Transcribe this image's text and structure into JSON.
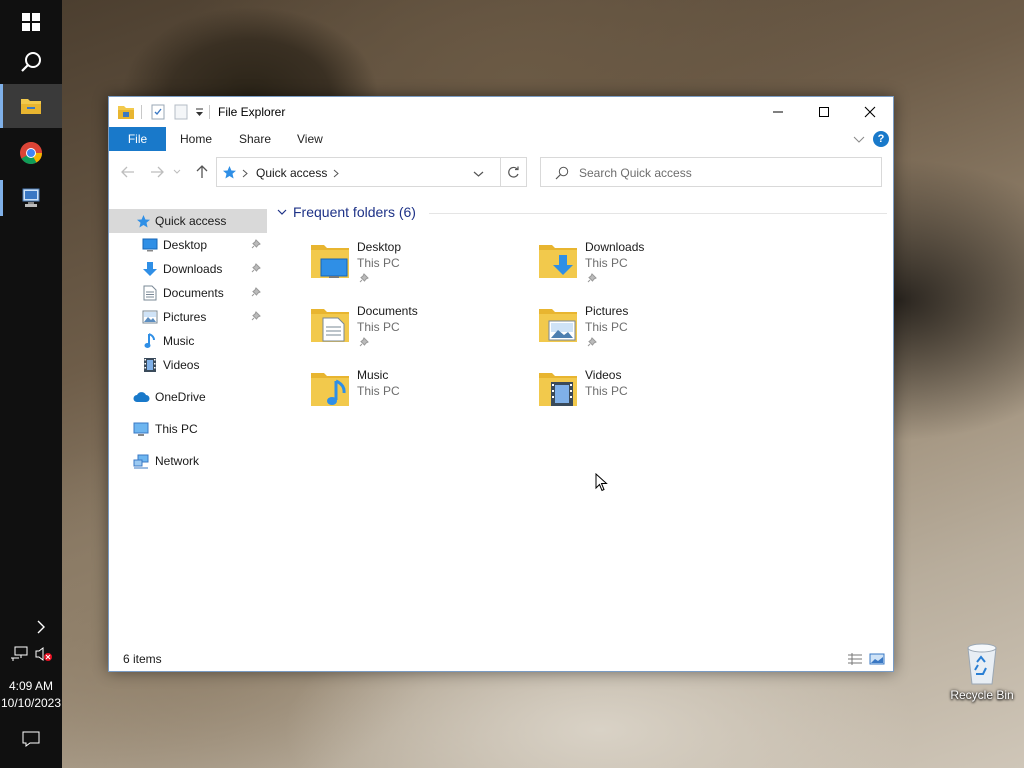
{
  "window": {
    "title": "File Explorer"
  },
  "ribbon": {
    "tabs": [
      "File",
      "Home",
      "Share",
      "View"
    ]
  },
  "address": {
    "location": "Quick access",
    "search_placeholder": "Search Quick access"
  },
  "nav": {
    "quick_access": "Quick access",
    "pinned": [
      {
        "label": "Desktop",
        "icon": "desktop-icon",
        "pinned": true
      },
      {
        "label": "Downloads",
        "icon": "download-icon",
        "pinned": true
      },
      {
        "label": "Documents",
        "icon": "document-icon",
        "pinned": true
      },
      {
        "label": "Pictures",
        "icon": "picture-icon",
        "pinned": true
      },
      {
        "label": "Music",
        "icon": "music-icon",
        "pinned": false
      },
      {
        "label": "Videos",
        "icon": "video-icon",
        "pinned": false
      }
    ],
    "onedrive": "OneDrive",
    "this_pc": "This PC",
    "network": "Network"
  },
  "content": {
    "group_title": "Frequent folders (6)",
    "folders": [
      {
        "name": "Desktop",
        "location": "This PC",
        "pinned": true
      },
      {
        "name": "Downloads",
        "location": "This PC",
        "pinned": true
      },
      {
        "name": "Documents",
        "location": "This PC",
        "pinned": true
      },
      {
        "name": "Pictures",
        "location": "This PC",
        "pinned": true
      },
      {
        "name": "Music",
        "location": "This PC",
        "pinned": false
      },
      {
        "name": "Videos",
        "location": "This PC",
        "pinned": false
      }
    ]
  },
  "status": {
    "item_count": "6 items"
  },
  "taskbar": {
    "time": "4:09 AM",
    "date": "10/10/2023"
  },
  "desktop": {
    "recycle_bin": "Recycle Bin"
  },
  "colors": {
    "accent": "#1979ca",
    "folder": "#f2c94c",
    "link_blue": "#1e3287"
  }
}
